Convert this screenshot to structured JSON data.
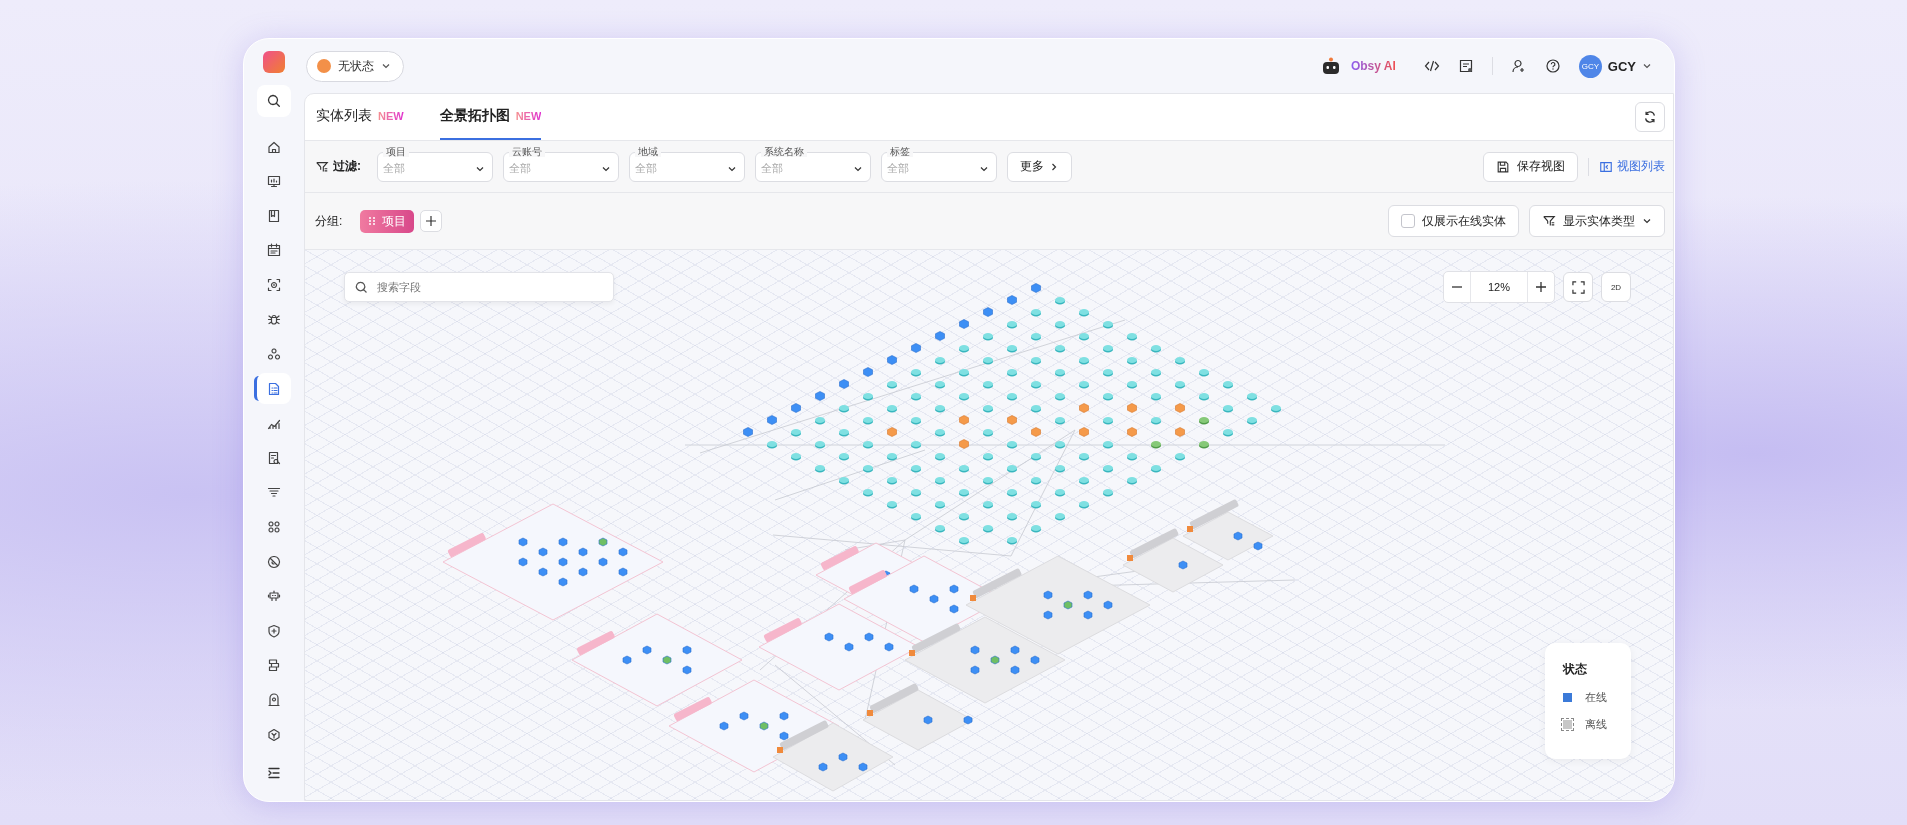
{
  "status_button": {
    "label": "无状态"
  },
  "header": {
    "ai_label": "Obsy AI",
    "user": {
      "avatar": "GCY",
      "name": "GCY"
    }
  },
  "sidebar": {
    "items": [
      {
        "selected": false
      },
      {
        "selected": false
      },
      {
        "selected": false
      },
      {
        "selected": false
      },
      {
        "selected": false
      },
      {
        "selected": false
      },
      {
        "selected": false
      },
      {
        "selected": true
      },
      {
        "selected": false
      },
      {
        "selected": false
      },
      {
        "selected": false
      },
      {
        "selected": false
      },
      {
        "selected": false
      },
      {
        "selected": false
      },
      {
        "selected": false
      },
      {
        "selected": false
      },
      {
        "selected": false
      },
      {
        "selected": false
      }
    ]
  },
  "tabs": [
    {
      "label": "实体列表",
      "badge": "NEW",
      "selected": false
    },
    {
      "label": "全景拓扑图",
      "badge": "NEW",
      "selected": true
    }
  ],
  "filters": {
    "label": "过滤:",
    "fields": [
      {
        "label": "项目",
        "placeholder": "全部"
      },
      {
        "label": "云账号",
        "placeholder": "全部"
      },
      {
        "label": "地域",
        "placeholder": "全部"
      },
      {
        "label": "系统名称",
        "placeholder": "全部"
      },
      {
        "label": "标签",
        "placeholder": "全部"
      }
    ],
    "more": "更多",
    "save_view": "保存视图",
    "view_list": "视图列表"
  },
  "grouping": {
    "label": "分组:",
    "chips": [
      "项目"
    ],
    "online_only": {
      "label": "仅展示在线实体",
      "checked": false
    },
    "entity_type_button": "显示实体类型"
  },
  "canvas": {
    "search": {
      "placeholder": "搜索字段"
    },
    "zoom": "12%",
    "view_mode": "2D"
  },
  "legend": {
    "title": "状态",
    "items": [
      {
        "kind": "online",
        "label": "在线"
      },
      {
        "kind": "offline",
        "label": "离线"
      }
    ]
  }
}
